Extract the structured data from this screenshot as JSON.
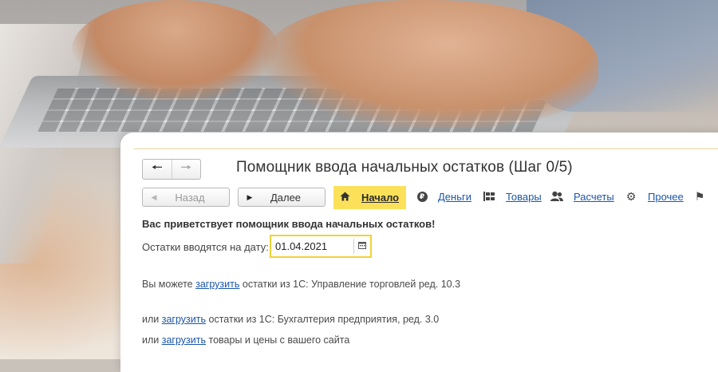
{
  "background": {
    "photo": "hands typing on laptop keyboard"
  },
  "nav": {
    "back_icon": "arrow-left-icon",
    "forward_icon": "arrow-right-icon"
  },
  "header": {
    "title": "Помощник ввода начальных остатков (Шаг 0/5)"
  },
  "buttons": {
    "back": "Назад",
    "next": "Далее"
  },
  "sections": [
    {
      "label": "Начало",
      "icon": "home-icon",
      "active": true
    },
    {
      "label": "Деньги",
      "icon": "ruble-icon",
      "active": false
    },
    {
      "label": "Товары",
      "icon": "boxes-icon",
      "active": false
    },
    {
      "label": "Расчеты",
      "icon": "users-icon",
      "active": false
    },
    {
      "label": "Прочее",
      "icon": "gear-icon",
      "active": false
    },
    {
      "label": "",
      "icon": "flag-icon",
      "active": false
    }
  ],
  "main": {
    "welcome": "Вас приветствует помощник ввода начальных остатков!",
    "date_label": "Остатки вводятся на дату:",
    "date_value": "01.04.2021",
    "line1_prefix": "Вы можете",
    "line1_link": "загрузить",
    "line1_suffix": "остатки из 1С: Управление торговлей ред. 10.3",
    "line2_prefix": "или",
    "line2_link": "загрузить",
    "line2_suffix": "остатки из 1С: Бухгалтерия предприятия, ред. 3.0",
    "line3_prefix": "или",
    "line3_link": "загрузить",
    "line3_suffix": "товары и цены с вашего сайта"
  },
  "colors": {
    "accent_yellow": "#fbe15a",
    "link_blue": "#1c56a8"
  }
}
